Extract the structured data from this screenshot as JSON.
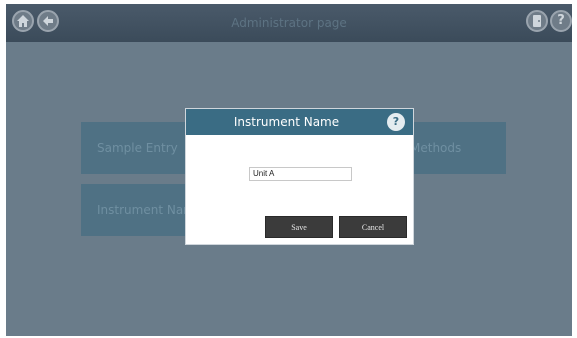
{
  "header": {
    "title": "Administrator page",
    "left_icons": [
      "home-icon",
      "back-arrow-icon"
    ],
    "right_icons": [
      "exit-door-icon",
      "help-icon"
    ],
    "help_glyph": "?"
  },
  "tiles": [
    {
      "label": "Sample Entry"
    },
    {
      "label": "Methods"
    },
    {
      "label": "Instrument Name"
    }
  ],
  "dialog": {
    "title": "Instrument Name",
    "help_glyph": "?",
    "field_value": "Unit A",
    "save_label": "Save",
    "cancel_label": "Cancel"
  },
  "colors": {
    "header": "#3b4b5a",
    "background": "#6a7c8a",
    "tile": "#4f7184",
    "dialog_header": "#3a6c84",
    "button": "#3b3b3b"
  }
}
